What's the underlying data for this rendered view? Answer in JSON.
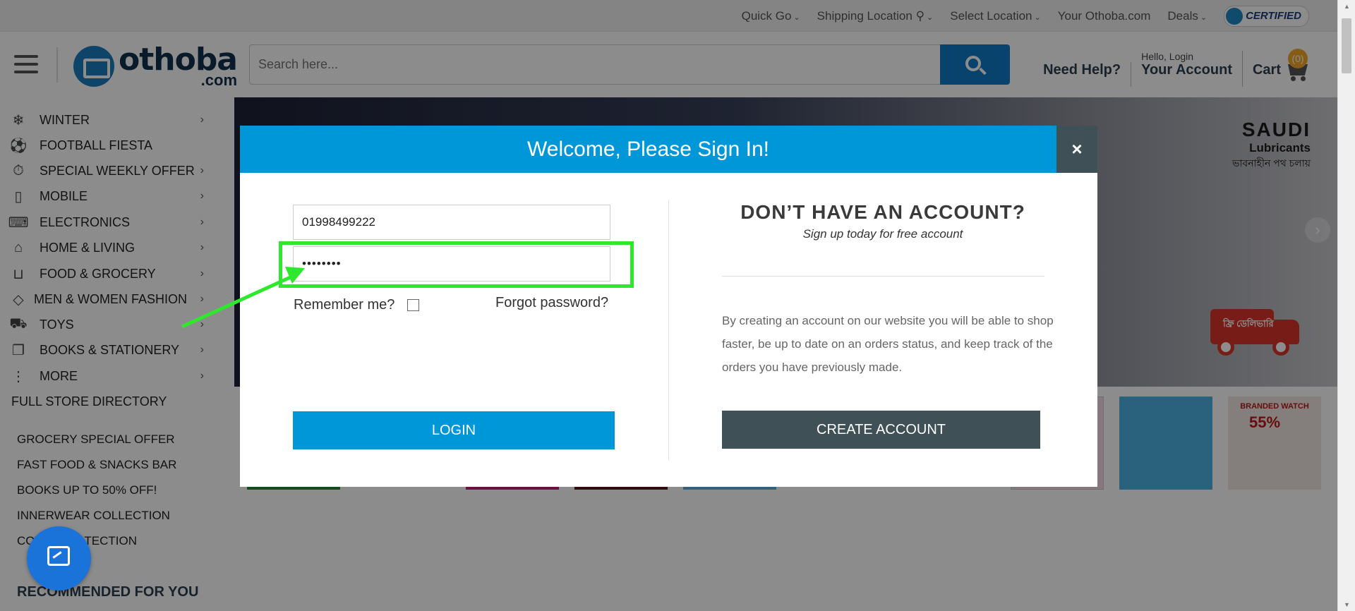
{
  "topbar": {
    "links": [
      "Quick Go",
      "Shipping Location",
      "Select Location",
      "Your Othoba.com",
      "Deals"
    ],
    "certified": "CERTIFIED"
  },
  "header": {
    "logo_main": "othoba",
    "logo_sub": ".com",
    "search_placeholder": "Search here...",
    "need_help": "Need Help?",
    "hello": "Hello, Login",
    "your_account": "Your Account",
    "cart_label": "Cart",
    "cart_count": "(0)"
  },
  "sidebar": {
    "categories": [
      {
        "label": "WINTER",
        "icon": "snowflake-icon",
        "glyph": "❄"
      },
      {
        "label": "FOOTBALL FIESTA",
        "icon": "football-icon",
        "glyph": "⚽"
      },
      {
        "label": "SPECIAL WEEKLY OFFER",
        "icon": "stopwatch-icon",
        "glyph": "⏱"
      },
      {
        "label": "MOBILE",
        "icon": "mobile-icon",
        "glyph": "▯"
      },
      {
        "label": "ELECTRONICS",
        "icon": "electronics-icon",
        "glyph": "⌨"
      },
      {
        "label": "HOME & LIVING",
        "icon": "home-icon",
        "glyph": "⌂"
      },
      {
        "label": "FOOD & GROCERY",
        "icon": "basket-icon",
        "glyph": "⊔"
      },
      {
        "label": "MEN & WOMEN FASHION",
        "icon": "diamond-icon",
        "glyph": "◇"
      },
      {
        "label": "TOYS",
        "icon": "toy-icon",
        "glyph": "⛟"
      },
      {
        "label": "BOOKS & STATIONERY",
        "icon": "book-icon",
        "glyph": "❐"
      },
      {
        "label": "MORE",
        "icon": "more-icon",
        "glyph": "⋮"
      }
    ],
    "directory": "FULL STORE DIRECTORY",
    "offers": [
      "GROCERY SPECIAL OFFER",
      "FAST FOOD & SNACKS BAR",
      "BOOKS UP TO 50% OFF!",
      "INNERWEAR COLLECTION",
      "COVID PROTECTION"
    ],
    "recommended": "RECOMMENDED FOR YOU"
  },
  "banner": {
    "brand": "SAUDI",
    "brand_sub": "Lubricants",
    "brand_tag": "ভাবনাহীন পথ চলায়",
    "truck_text": "ফ্রি ডেলিভারি"
  },
  "tiles": {
    "branded_watch": "BRANDED WATCH",
    "watch_pct": "55%"
  },
  "modal": {
    "title": "Welcome, Please Sign In!",
    "close": "×",
    "username_value": "01998499222",
    "password_value": "••••••••",
    "remember": "Remember me?",
    "forgot": "Forgot password?",
    "login": "LOGIN",
    "right_title": "DON’T HAVE AN ACCOUNT?",
    "right_sub": "Sign up today for free account",
    "right_desc": "By creating an account on our website you will be able to shop faster, be up to date on an orders status, and keep track of the orders you have previously made.",
    "create": "CREATE ACCOUNT"
  },
  "colors": {
    "primary": "#0097d8",
    "dark": "#3f5156",
    "highlight": "#2ee82e"
  }
}
